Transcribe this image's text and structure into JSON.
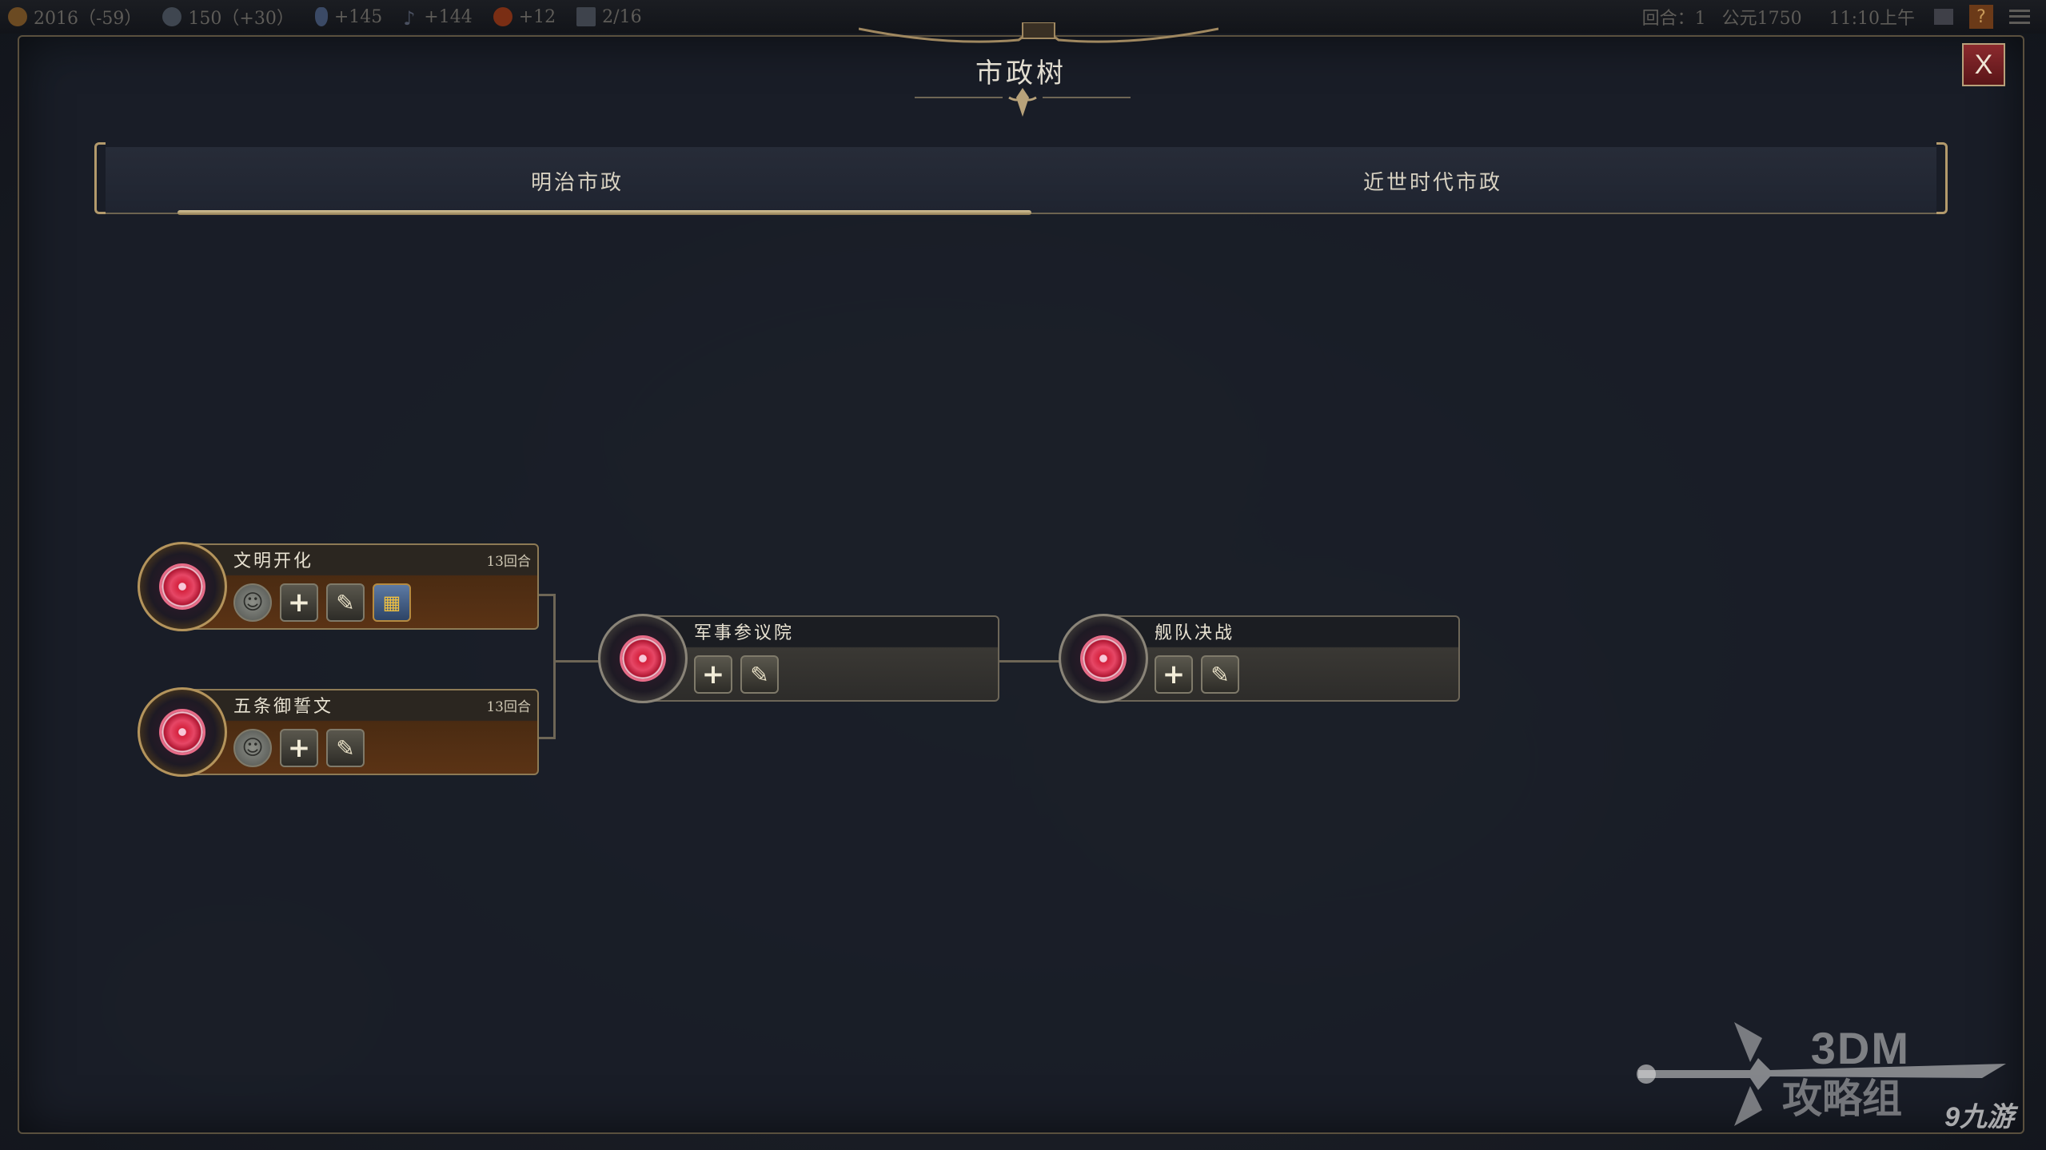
{
  "topbar": {
    "science": "2016（-59）",
    "gold": "150（+30）",
    "faith": "+145",
    "culture": "+144",
    "tourism": "+12",
    "cities": "2/16",
    "turn": "回合：1",
    "year": "公元1750",
    "time": "11:10上午"
  },
  "panel": {
    "title": "市政树",
    "close_label": "X"
  },
  "tabs": [
    {
      "label": "明治市政",
      "active": true
    },
    {
      "label": "近世时代市政",
      "active": false
    }
  ],
  "civics": [
    {
      "name": "文明开化",
      "turns": "13回合",
      "style": "brown",
      "icons": [
        "portrait-icon",
        "plus-icon",
        "quill-icon",
        "building-icon"
      ]
    },
    {
      "name": "五条御誓文",
      "turns": "13回合",
      "style": "brown",
      "icons": [
        "portrait-icon",
        "plus-icon",
        "quill-icon"
      ]
    },
    {
      "name": "军事参议院",
      "turns": "",
      "style": "gray",
      "icons": [
        "plus-icon",
        "quill-icon"
      ]
    },
    {
      "name": "舰队决战",
      "turns": "",
      "style": "gray",
      "icons": [
        "plus-icon",
        "quill-icon"
      ]
    }
  ],
  "watermark": {
    "brand": "3DM",
    "sub": "攻略组",
    "site": "九游"
  },
  "colors": {
    "panel_bg": "#1a1e28",
    "gold_trim": "#b39a6c",
    "close_red": "#8c2a2e",
    "civic_brown": "#5b3315"
  }
}
